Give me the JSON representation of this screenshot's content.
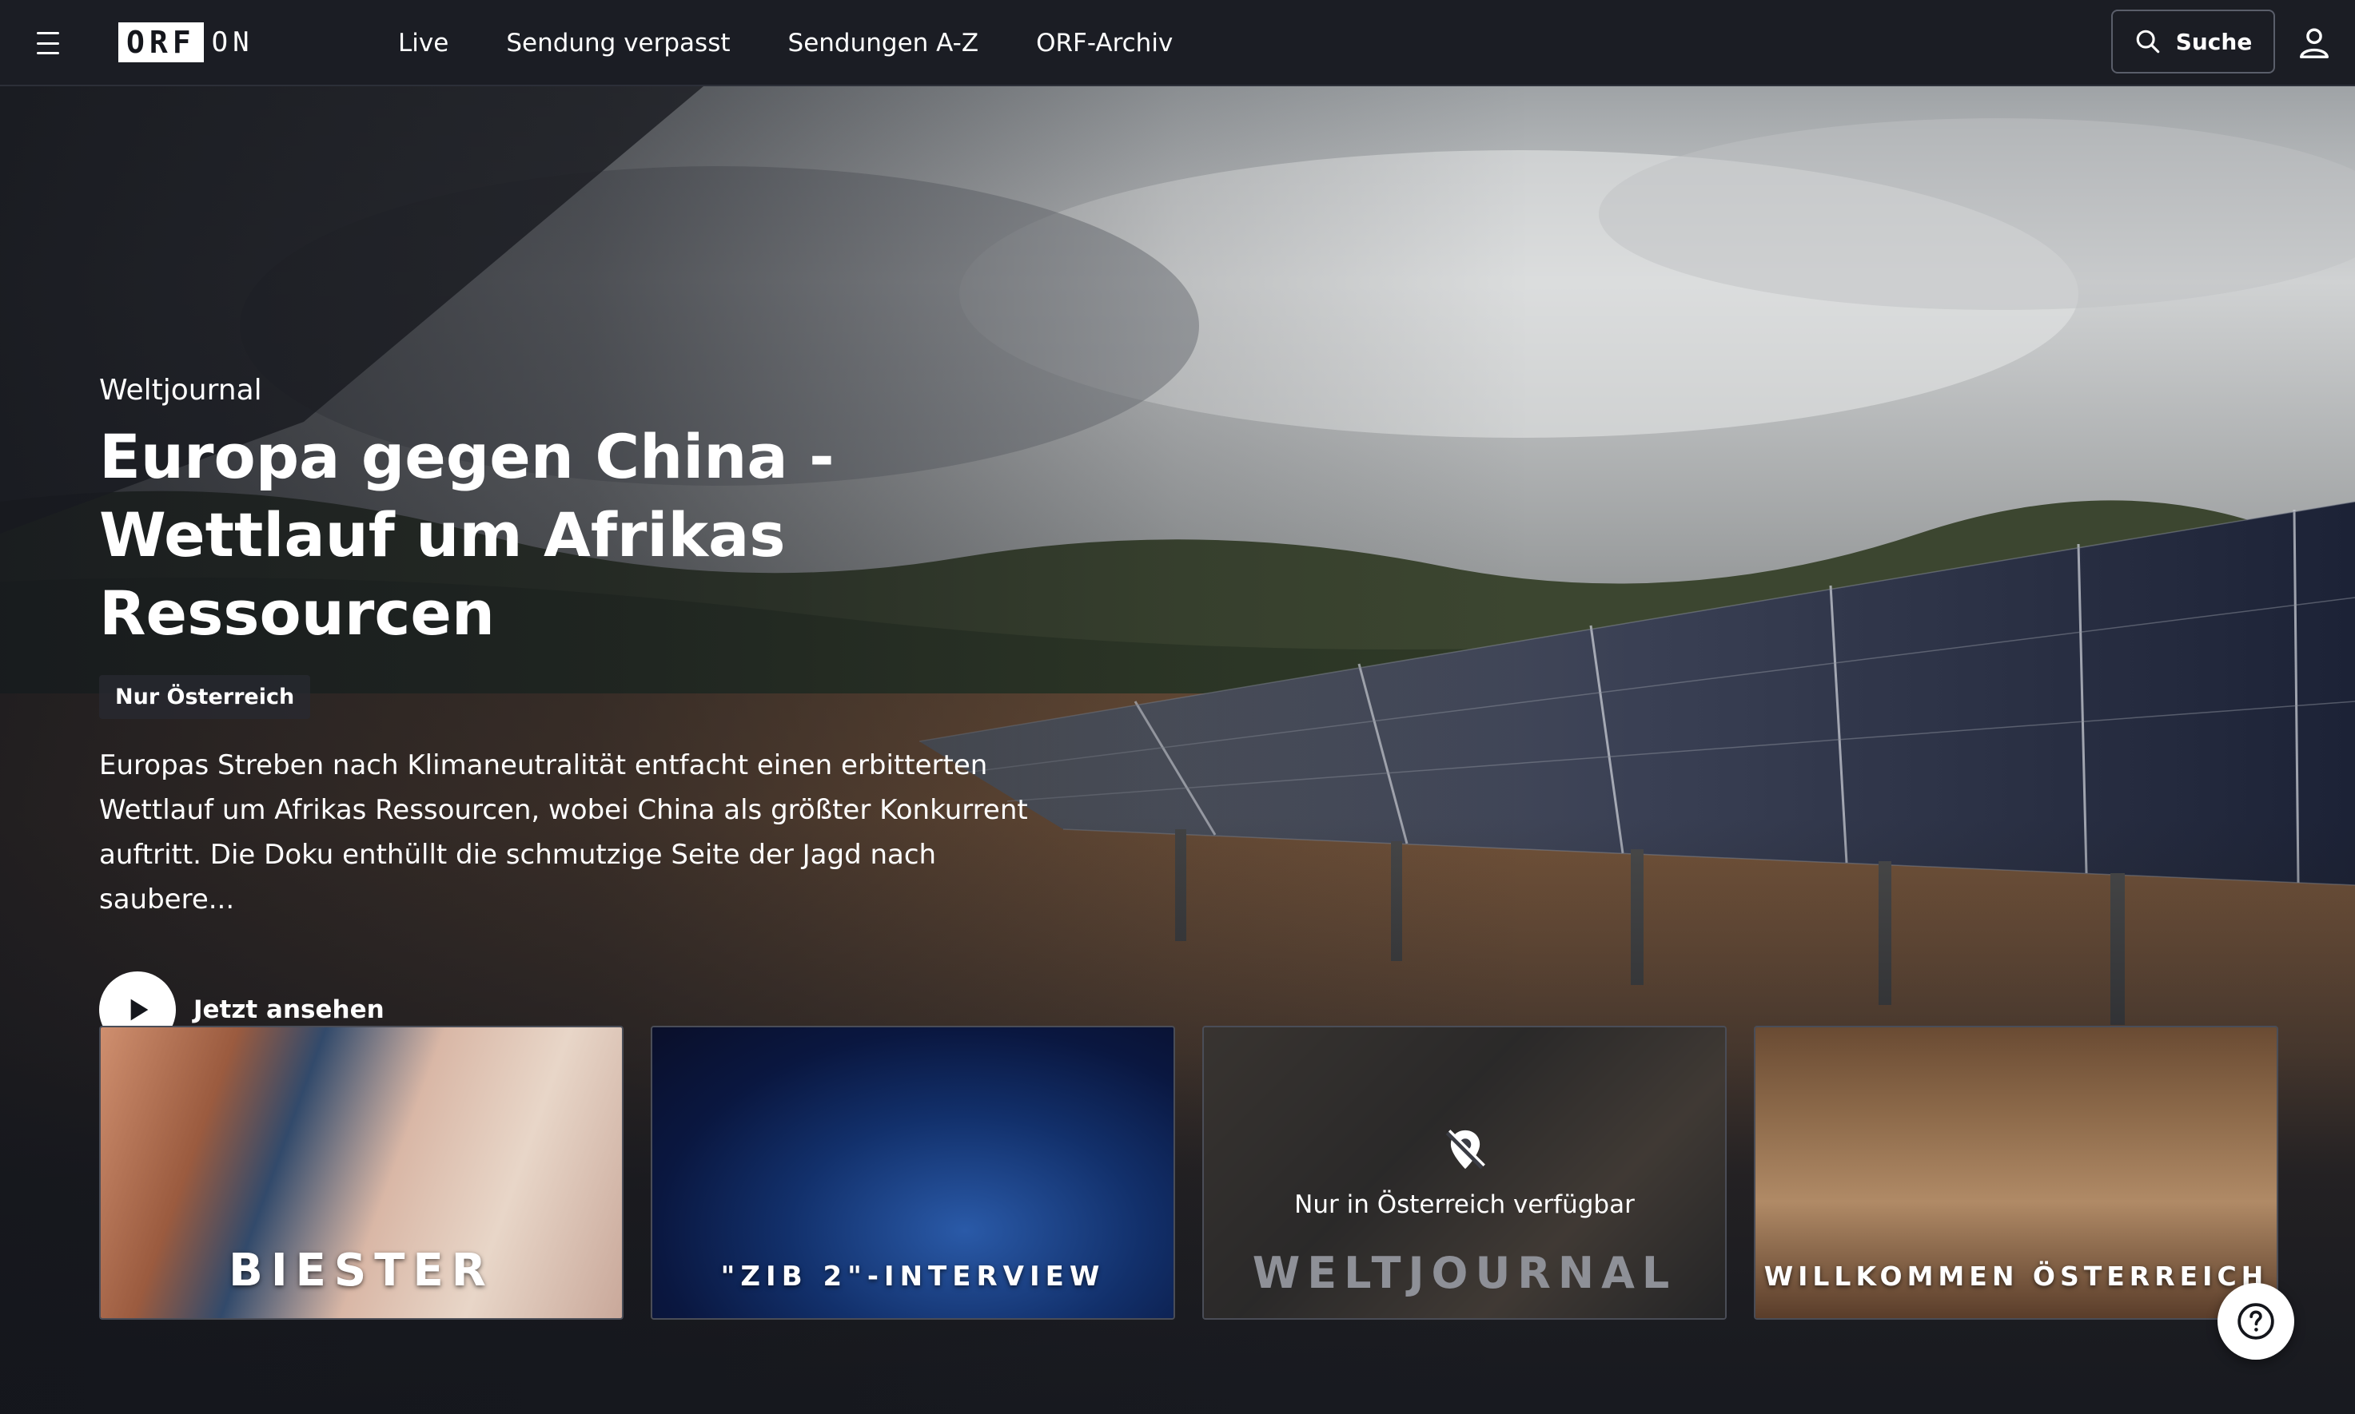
{
  "brand": {
    "logo_box": "ORF",
    "logo_suffix": "ON"
  },
  "nav": {
    "items": [
      "Live",
      "Sendung verpasst",
      "Sendungen A-Z",
      "ORF-Archiv"
    ]
  },
  "search": {
    "label": "Suche"
  },
  "hero": {
    "series": "Weltjournal",
    "title": "Europa gegen China - Wettlauf um Afrikas Ressourcen",
    "badge": "Nur Österreich",
    "description": "Europas Streben nach Klimaneutralität entfacht einen erbitterten Wettlauf um Afrikas Ressourcen, wobei China als größter Konkurrent auftritt. Die Doku enthüllt die schmutzige Seite der Jagd nach saubere...",
    "play_label": "Jetzt ansehen"
  },
  "teasers": [
    {
      "title": "BIESTER"
    },
    {
      "title": "\"ZIB 2\"-INTERVIEW"
    },
    {
      "title": "WELTJOURNAL",
      "geo_text": "Nur in Österreich verfügbar"
    },
    {
      "title": "WILLKOMMEN ÖSTERREICH"
    }
  ],
  "icons": {
    "menu": "hamburger-menu-icon",
    "search": "search-icon",
    "user": "user-icon",
    "play": "play-icon",
    "geo": "location-blocked-icon",
    "help": "question-mark-icon"
  }
}
